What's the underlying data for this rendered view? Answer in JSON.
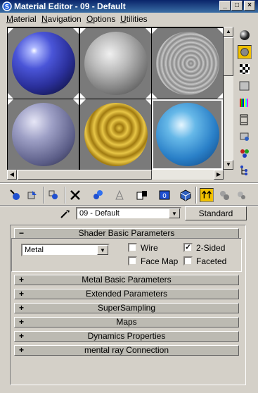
{
  "window": {
    "title": "Material Editor - 09 - Default",
    "buttons": [
      "_",
      "□",
      "×"
    ]
  },
  "menu": [
    {
      "label": "Material",
      "u": "M",
      "rest": "aterial"
    },
    {
      "label": "Navigation",
      "u": "N",
      "rest": "avigation"
    },
    {
      "label": "Options",
      "u": "O",
      "rest": "ptions"
    },
    {
      "label": "Utilities",
      "u": "U",
      "rest": "tilities"
    }
  ],
  "slots": [
    {
      "name": "blue-glossy",
      "style": "radial-gradient(circle at 35% 30%, #ffffff 0%, #aeb8ff 6%, #4a55d8 30%, #2a2f9a 60%, #0f1240 90%)"
    },
    {
      "name": "gray-noise",
      "style": "radial-gradient(circle at 40% 35%, #f0f0f0 0%, #b8b8b8 35%, #6c6c6c 75%, #303030 100%)"
    },
    {
      "name": "wood-gray",
      "style": "repeating-radial-gradient(circle at 55% 50%, #bcbcbc 0px, #888 3px, #d0d0d0 6px), radial-gradient(circle,#aaa,#444)"
    },
    {
      "name": "blue-gray-matte",
      "style": "radial-gradient(circle at 35% 30%, #e6e6f6 0%, #9ea0c6 30%, #5a5c86 70%, #24253a 100%)"
    },
    {
      "name": "gold-rings",
      "style": "repeating-radial-gradient(circle at 55% 40%, #e8c646 0px, #a07a10 6px, #e8c646 12px)"
    },
    {
      "name": "blue-marble",
      "style": "radial-gradient(circle at 40% 35%, #e6f6ff 0%, #66b8e8 25%, #2a80c8 60%, #0c3e7a 100%)"
    }
  ],
  "material_name": "09 - Default",
  "material_type": "Standard",
  "shader_rollout": {
    "title": "Shader Basic Parameters",
    "toggle": "−",
    "shader": "Metal",
    "options": [
      {
        "label": "Wire",
        "checked": false
      },
      {
        "label": "2-Sided",
        "checked": true
      },
      {
        "label": "Face Map",
        "checked": false
      },
      {
        "label": "Faceted",
        "checked": false
      }
    ]
  },
  "rollouts": [
    {
      "title": "Metal Basic Parameters",
      "toggle": "+"
    },
    {
      "title": "Extended Parameters",
      "toggle": "+"
    },
    {
      "title": "SuperSampling",
      "toggle": "+"
    },
    {
      "title": "Maps",
      "toggle": "+"
    },
    {
      "title": "Dynamics Properties",
      "toggle": "+"
    },
    {
      "title": "mental ray Connection",
      "toggle": "+"
    }
  ],
  "sidebar_icons": [
    "sample-type-sphere-icon",
    "backlight-icon",
    "background-checker-icon",
    "uv-tiling-icon",
    "video-color-check-icon",
    "make-preview-icon",
    "material-options-icon",
    "select-by-material-icon",
    "material-map-navigator-icon"
  ],
  "toolbar_icons": [
    "get-material-icon",
    "put-to-scene-icon",
    "assign-to-selection-icon",
    "reset-map-icon",
    "make-unique-icon",
    "put-to-library-icon",
    "material-id-channel-icon",
    "show-map-in-viewport-icon",
    "show-end-result-icon",
    "go-to-parent-icon",
    "go-forward-to-sibling-icon"
  ]
}
